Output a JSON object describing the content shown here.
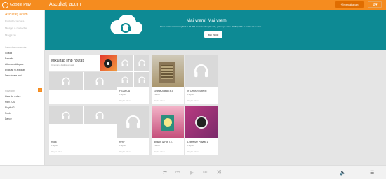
{
  "app": {
    "name": "Google Play",
    "page_title": "Ascultați acum"
  },
  "header": {
    "upgrade_label": "+ Încercați acum",
    "settings_icon": "gear-icon"
  },
  "sidebar": {
    "main": [
      {
        "label": "Ascultați acum",
        "active": true
      },
      {
        "label": "Biblioteca mea",
        "active": false
      },
      {
        "label": "Merge o melodie",
        "active": false
      },
      {
        "label": "Magazin",
        "active": false
      }
    ],
    "section_title": "Instruct necunoscute",
    "sub_items": [
      "Coadă",
      "Favorite",
      "Albume adăugate",
      "Evaluări și aprobări",
      "Descărcate mai"
    ],
    "playlists_title": "Playlisturi",
    "playlists": [
      "Lista de redare",
      "MEKTUS",
      "Playlist 2",
      "Rock",
      "Dance"
    ]
  },
  "banner": {
    "title": "Mai vrem! Mai vrem!",
    "subtitle": "Acum poate să încarci până la 50.000 melodii adăugate tale, gratuit pe orice alt dispozitiv te poate să se face",
    "button": "Mai încolo"
  },
  "feature": {
    "title": "Mixaj tab limb noutăți",
    "subtitle": "Incercați o dată prea jucați"
  },
  "cards": [
    {
      "title": "FIGARCA",
      "sub": "Playlist",
      "foot": "Playlist album"
    },
    {
      "title": "Grome Zideau 8.3",
      "sub": "Playlist",
      "foot": "Playlist album"
    },
    {
      "title": "In Cerivuri Selectii",
      "sub": "Playlist",
      "foot": "Playlist album"
    },
    {
      "title": "Rock",
      "sub": "Playlist",
      "foot": "Playlist album"
    },
    {
      "title": "RHIF",
      "sub": "Playlist",
      "foot": "Playlist album"
    },
    {
      "title": "Brilliant & Hot T.E.",
      "sub": "Playlist",
      "foot": "Playlist album"
    },
    {
      "title": "Leave Me Playlist 1",
      "sub": "Playlist",
      "foot": "Playlist album"
    }
  ],
  "colors": {
    "accent": "#f58c1f",
    "banner": "#0d8a94"
  }
}
